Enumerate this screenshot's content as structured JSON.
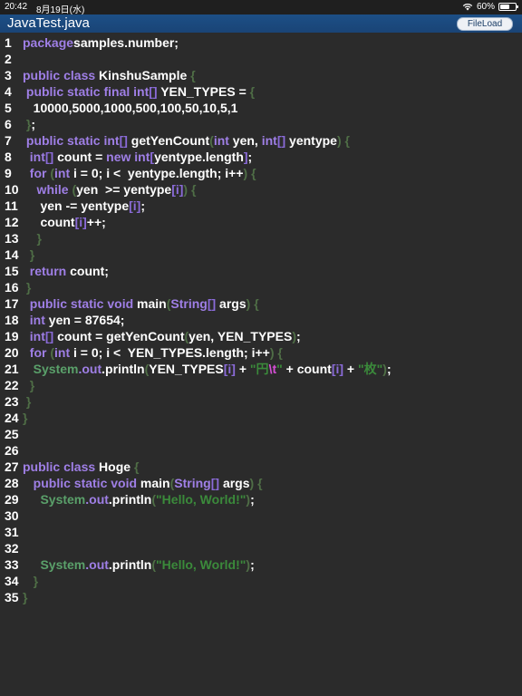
{
  "status_bar": {
    "time": "20:42",
    "date": "8月19日(水)",
    "battery": "60%",
    "battery_level": 0.6
  },
  "title_bar": {
    "title": "JavaTest.java",
    "file_load_label": "FileLoad"
  },
  "colors": {
    "keyword": "#9f7fe6",
    "brace": "#4f6e46",
    "string": "#3b8a3b",
    "escape": "#d64fd6",
    "background": "#2b2b2b",
    "titlebar": "#1c4f86"
  },
  "code_lines": [
    {
      "n": "1",
      "t": [
        [
          "kw",
          "package"
        ],
        [
          "",
          "samples.number;"
        ]
      ]
    },
    {
      "n": "2",
      "t": []
    },
    {
      "n": "3",
      "t": [
        [
          "kw",
          "public class"
        ],
        [
          "",
          " KinshuSample "
        ],
        [
          "br",
          "{"
        ]
      ]
    },
    {
      "n": "4",
      "t": [
        [
          "kw",
          " public static final int"
        ],
        [
          "sq",
          "[]"
        ],
        [
          "",
          " YEN_TYPES = "
        ],
        [
          "br",
          "{"
        ]
      ]
    },
    {
      "n": "5",
      "t": [
        [
          "",
          "   10000,5000,1000,500,100,50,10,5,1"
        ]
      ]
    },
    {
      "n": "6",
      "t": [
        [
          "br",
          " }"
        ],
        [
          "",
          ";"
        ]
      ]
    },
    {
      "n": "7",
      "t": [
        [
          "kw",
          " public static int"
        ],
        [
          "sq",
          "[]"
        ],
        [
          "",
          " getYenCount"
        ],
        [
          "br",
          "("
        ],
        [
          "kw",
          "int"
        ],
        [
          "",
          " yen, "
        ],
        [
          "kw",
          "int"
        ],
        [
          "sq",
          "[]"
        ],
        [
          "",
          " yentype"
        ],
        [
          "br",
          ")"
        ],
        [
          "",
          " "
        ],
        [
          "br",
          "{"
        ]
      ]
    },
    {
      "n": "8",
      "t": [
        [
          "kw",
          "  int"
        ],
        [
          "sq",
          "[]"
        ],
        [
          "",
          " count = "
        ],
        [
          "kw",
          "new int"
        ],
        [
          "sq",
          "["
        ],
        [
          "",
          "yentype.length"
        ],
        [
          "sq",
          "]"
        ],
        [
          "",
          ";"
        ]
      ]
    },
    {
      "n": "9",
      "t": [
        [
          "kw",
          "  for"
        ],
        [
          "",
          " "
        ],
        [
          "br",
          "("
        ],
        [
          "kw",
          "int"
        ],
        [
          "",
          " i = 0; i <  yentype.length; i++"
        ],
        [
          "br",
          ")"
        ],
        [
          "",
          " "
        ],
        [
          "br",
          "{"
        ]
      ]
    },
    {
      "n": "10",
      "t": [
        [
          "kw",
          "    while"
        ],
        [
          "",
          " "
        ],
        [
          "br",
          "("
        ],
        [
          "",
          "yen  >= yentype"
        ],
        [
          "sq",
          "[i]"
        ],
        [
          "br",
          ")"
        ],
        [
          "",
          " "
        ],
        [
          "br",
          "{"
        ]
      ]
    },
    {
      "n": "11",
      "t": [
        [
          "",
          "     yen -= yentype"
        ],
        [
          "sq",
          "[i]"
        ],
        [
          "",
          ";"
        ]
      ]
    },
    {
      "n": "12",
      "t": [
        [
          "",
          "     count"
        ],
        [
          "sq",
          "[i]"
        ],
        [
          "",
          "++;"
        ]
      ]
    },
    {
      "n": "13",
      "t": [
        [
          "br",
          "    }"
        ]
      ]
    },
    {
      "n": "14",
      "t": [
        [
          "br",
          "  }"
        ]
      ]
    },
    {
      "n": "15",
      "t": [
        [
          "kw",
          "  return"
        ],
        [
          "",
          " count;"
        ]
      ]
    },
    {
      "n": "16",
      "t": [
        [
          "br",
          " }"
        ]
      ]
    },
    {
      "n": "17",
      "t": [
        [
          "kw",
          "  public static void"
        ],
        [
          "",
          " main"
        ],
        [
          "br",
          "("
        ],
        [
          "kw",
          "String"
        ],
        [
          "sq",
          "[]"
        ],
        [
          "",
          " args"
        ],
        [
          "br",
          ")"
        ],
        [
          "",
          " "
        ],
        [
          "br",
          "{"
        ]
      ]
    },
    {
      "n": "18",
      "t": [
        [
          "kw",
          "  int"
        ],
        [
          "",
          " yen = 87654;"
        ]
      ]
    },
    {
      "n": "19",
      "t": [
        [
          "kw",
          "  int"
        ],
        [
          "sq",
          "[]"
        ],
        [
          "",
          " count = getYenCount"
        ],
        [
          "br",
          "("
        ],
        [
          "",
          "yen, YEN_TYPES"
        ],
        [
          "br",
          ")"
        ],
        [
          "",
          ";"
        ]
      ]
    },
    {
      "n": "20",
      "t": [
        [
          "kw",
          "  for"
        ],
        [
          "",
          " "
        ],
        [
          "br",
          "("
        ],
        [
          "kw",
          "int"
        ],
        [
          "",
          " i = 0; i <  YEN_TYPES.length; i++"
        ],
        [
          "br",
          ")"
        ],
        [
          "",
          " "
        ],
        [
          "br",
          "{"
        ]
      ]
    },
    {
      "n": "21",
      "t": [
        [
          "cls",
          "   System"
        ],
        [
          "",
          ""
        ],
        [
          "kw",
          ".out"
        ],
        [
          "",
          ".println"
        ],
        [
          "br",
          "("
        ],
        [
          "",
          "YEN_TYPES"
        ],
        [
          "sq",
          "[i]"
        ],
        [
          "",
          " + "
        ],
        [
          "str",
          "\"円"
        ],
        [
          "esc",
          "\\t"
        ],
        [
          "str",
          "\""
        ],
        [
          "",
          " + count"
        ],
        [
          "sq",
          "[i]"
        ],
        [
          "",
          " + "
        ],
        [
          "str",
          "\"枚\""
        ],
        [
          "br",
          ")"
        ],
        [
          "",
          ";"
        ]
      ]
    },
    {
      "n": "22",
      "t": [
        [
          "br",
          "  }"
        ]
      ]
    },
    {
      "n": "23",
      "t": [
        [
          "br",
          " }"
        ]
      ]
    },
    {
      "n": "24",
      "t": [
        [
          "br",
          "}"
        ]
      ]
    },
    {
      "n": "25",
      "t": []
    },
    {
      "n": "26",
      "t": []
    },
    {
      "n": "27",
      "t": [
        [
          "kw",
          "public class"
        ],
        [
          "",
          " Hoge "
        ],
        [
          "br",
          "{"
        ]
      ]
    },
    {
      "n": "28",
      "t": [
        [
          "kw",
          "   public static void"
        ],
        [
          "",
          " main"
        ],
        [
          "br",
          "("
        ],
        [
          "kw",
          "String"
        ],
        [
          "sq",
          "[]"
        ],
        [
          "",
          " args"
        ],
        [
          "br",
          ")"
        ],
        [
          "",
          " "
        ],
        [
          "br",
          "{"
        ]
      ]
    },
    {
      "n": "29",
      "t": [
        [
          "cls",
          "     System"
        ],
        [
          "kw",
          ".out"
        ],
        [
          "",
          ".println"
        ],
        [
          "br",
          "("
        ],
        [
          "str",
          "\"Hello, World!\""
        ],
        [
          "br",
          ")"
        ],
        [
          "",
          ";"
        ]
      ]
    },
    {
      "n": "30",
      "t": []
    },
    {
      "n": "31",
      "t": []
    },
    {
      "n": "32",
      "t": []
    },
    {
      "n": "33",
      "t": [
        [
          "cls",
          "     System"
        ],
        [
          "kw",
          ".out"
        ],
        [
          "",
          ".println"
        ],
        [
          "br",
          "("
        ],
        [
          "str",
          "\"Hello, World!\""
        ],
        [
          "br",
          ")"
        ],
        [
          "",
          ";"
        ]
      ]
    },
    {
      "n": "34",
      "t": [
        [
          "br",
          "   }"
        ]
      ]
    },
    {
      "n": "35",
      "t": [
        [
          "br",
          "}"
        ]
      ]
    }
  ]
}
